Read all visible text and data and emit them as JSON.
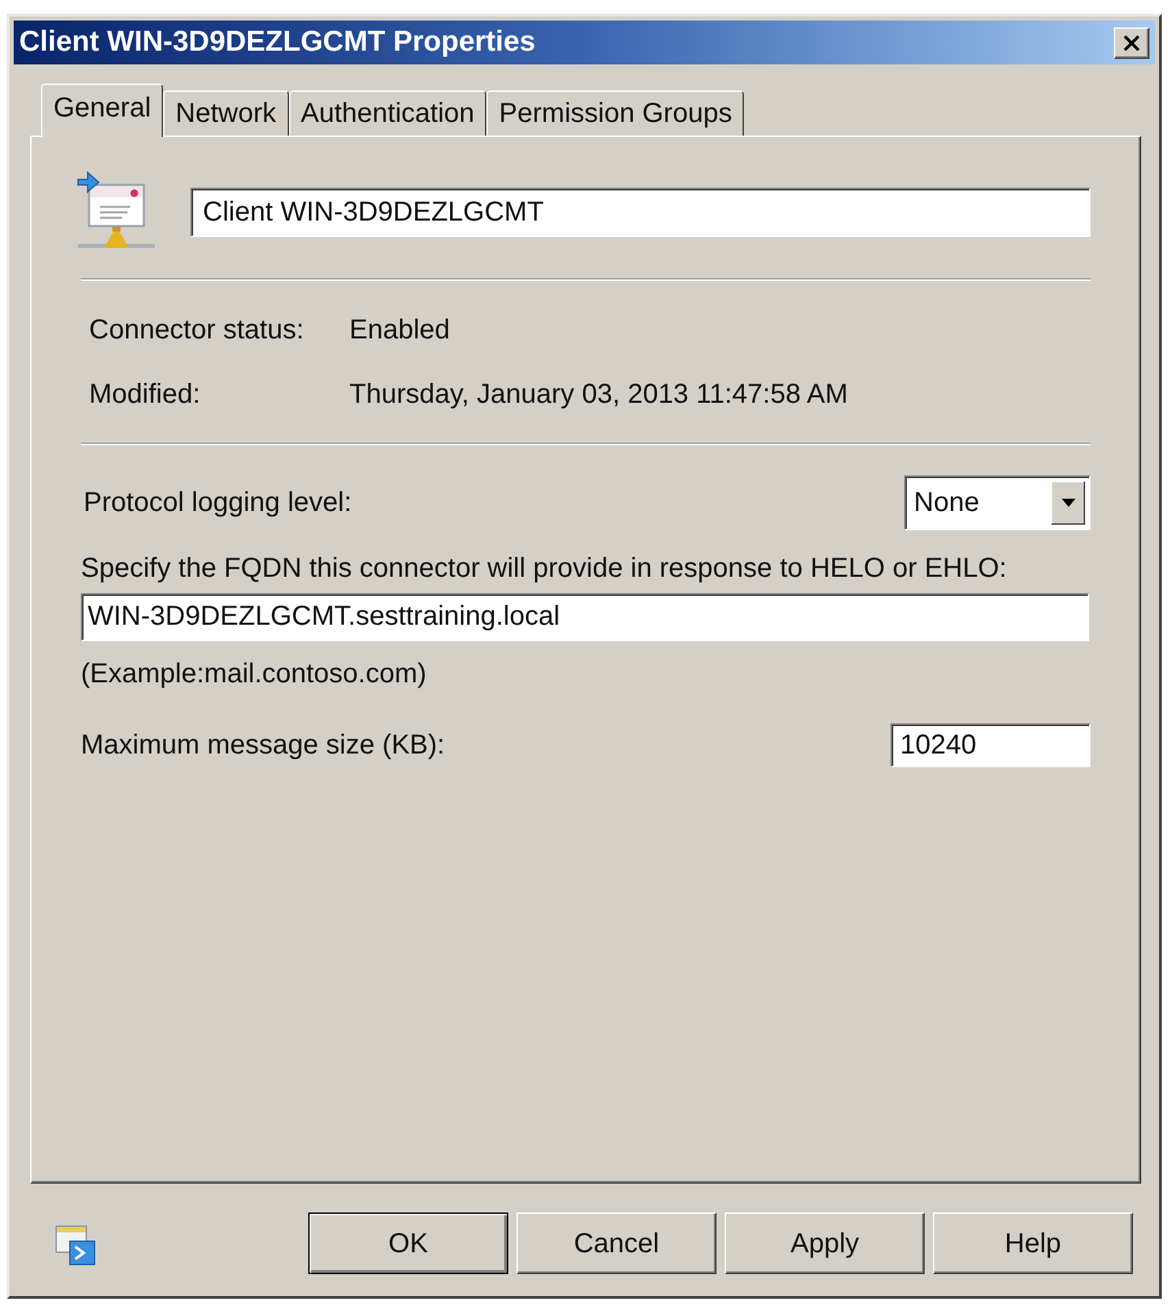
{
  "window": {
    "title": "Client WIN-3D9DEZLGCMT Properties"
  },
  "tabs": [
    {
      "label": "General",
      "selected": true
    },
    {
      "label": "Network",
      "selected": false
    },
    {
      "label": "Authentication",
      "selected": false
    },
    {
      "label": "Permission Groups",
      "selected": false
    }
  ],
  "general": {
    "name": "Client WIN-3D9DEZLGCMT",
    "info": [
      {
        "label": "Connector status:",
        "value": "Enabled"
      },
      {
        "label": "Modified:",
        "value": "Thursday, January 03, 2013 11:47:58 AM"
      }
    ],
    "protocol_logging": {
      "label": "Protocol logging level:",
      "value": "None"
    },
    "fqdn": {
      "label": "Specify the FQDN this connector will provide in response to HELO or EHLO:",
      "value": "WIN-3D9DEZLGCMT.sesttraining.local",
      "example": "(Example:mail.contoso.com)"
    },
    "max_message_size": {
      "label": "Maximum message size (KB):",
      "value": "10240"
    }
  },
  "buttons": [
    {
      "label": "OK",
      "default": true
    },
    {
      "label": "Cancel",
      "default": false
    },
    {
      "label": "Apply",
      "default": false
    },
    {
      "label": "Help",
      "default": false
    }
  ]
}
